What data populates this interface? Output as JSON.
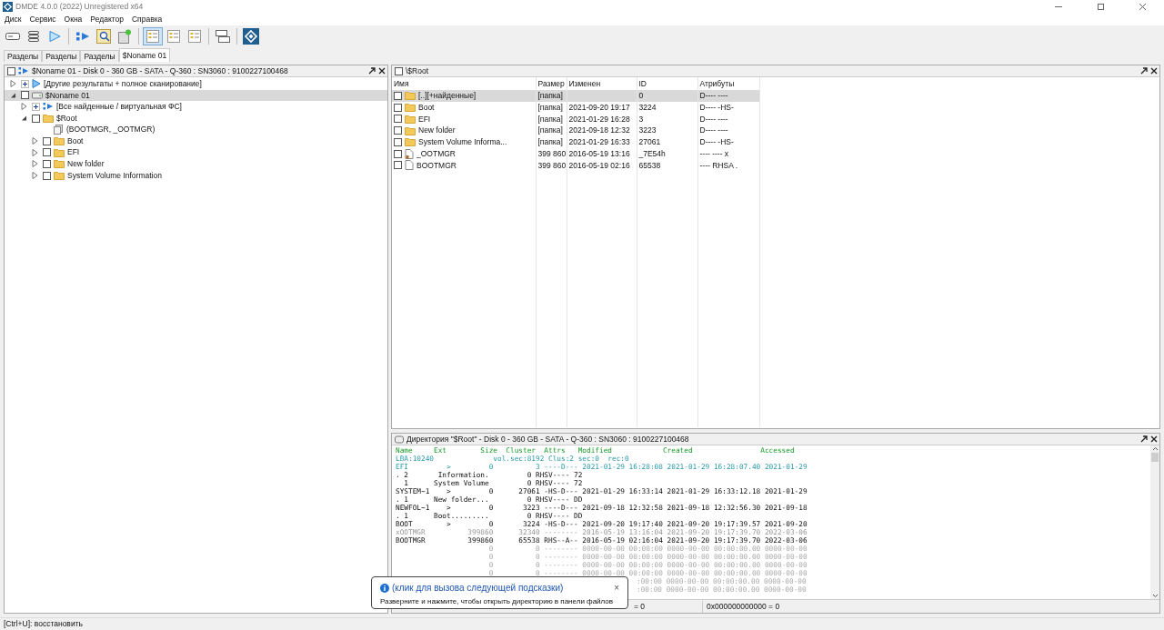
{
  "window": {
    "title": "DMDE 4.0.0 (2022) Unregistered x64"
  },
  "menu": [
    "Диск",
    "Сервис",
    "Окна",
    "Редактор",
    "Справка"
  ],
  "toolbar": [
    {
      "kind": "drive",
      "selected": false
    },
    {
      "kind": "list",
      "selected": false
    },
    {
      "kind": "play",
      "selected": false
    },
    {
      "kind": "sep"
    },
    {
      "kind": "scan",
      "selected": false
    },
    {
      "kind": "find",
      "selected": false
    },
    {
      "kind": "newfile",
      "selected": false
    },
    {
      "kind": "sep"
    },
    {
      "kind": "view",
      "selected": true
    },
    {
      "kind": "view",
      "selected": false
    },
    {
      "kind": "view",
      "selected": false
    },
    {
      "kind": "sep"
    },
    {
      "kind": "windows",
      "selected": false
    },
    {
      "kind": "sep"
    },
    {
      "kind": "logo",
      "selected": false
    }
  ],
  "tabs": [
    {
      "label": "Разделы",
      "selected": false
    },
    {
      "label": "Разделы",
      "selected": false
    },
    {
      "label": "Разделы",
      "selected": false
    },
    {
      "label": "$Noname 01",
      "selected": true
    }
  ],
  "tree_panel": {
    "title": "$Noname 01 - Disk 0 - 360 GB - SATA - Q-360 : SN3060 : 9100227100468",
    "checked": false,
    "items": [
      {
        "kind": "scan",
        "label": "[Другие результаты + полное сканирование]",
        "expanded": false,
        "selected": false
      },
      {
        "kind": "drive",
        "label": "$Noname 01",
        "expanded": true,
        "checked": false,
        "selected": true,
        "children": [
          {
            "kind": "virtual",
            "label": "[Все найденные / виртуальная ФС]",
            "expanded": false,
            "selected": false
          },
          {
            "kind": "folder",
            "label": "$Root",
            "expanded": true,
            "checked": false,
            "selected": false,
            "children": [
              {
                "kind": "files",
                "label": "(BOOTMGR, _OOTMGR)",
                "selected": false
              },
              {
                "kind": "folder",
                "label": "Boot",
                "expanded": false,
                "checked": false,
                "selected": false
              },
              {
                "kind": "folder",
                "label": "EFI",
                "expanded": false,
                "checked": false,
                "selected": false
              },
              {
                "kind": "folder",
                "label": "New folder",
                "expanded": false,
                "checked": false,
                "selected": false
              },
              {
                "kind": "folder",
                "label": "System Volume Information",
                "expanded": false,
                "checked": false,
                "selected": false
              }
            ]
          }
        ]
      }
    ]
  },
  "files_panel": {
    "title": "\\$Root",
    "checked": false,
    "columns": [
      "Имя",
      "Размер",
      "Изменен",
      "ID",
      "Атрибуты"
    ],
    "rows": [
      {
        "kind": "folder",
        "checked": false,
        "selected": true,
        "cells": [
          "[..][+найденные]",
          "[папка]",
          "",
          "0",
          "D---- ----"
        ]
      },
      {
        "kind": "folder",
        "checked": false,
        "selected": false,
        "cells": [
          "Boot",
          "[папка]",
          "2021-09-20 19:17",
          "3224",
          "D---- -HS-"
        ]
      },
      {
        "kind": "folder",
        "checked": false,
        "selected": false,
        "cells": [
          "EFI",
          "[папка]",
          "2021-01-29 16:28",
          "3",
          "D---- ----"
        ]
      },
      {
        "kind": "folder",
        "checked": false,
        "selected": false,
        "cells": [
          "New folder",
          "[папка]",
          "2021-09-18 12:32",
          "3223",
          "D---- ----"
        ]
      },
      {
        "kind": "folder",
        "checked": false,
        "selected": false,
        "cells": [
          "System Volume Informa...",
          "[папка]",
          "2021-01-29 16:33",
          "27061",
          "D---- -HS-"
        ]
      },
      {
        "kind": "deleted",
        "checked": false,
        "selected": false,
        "cells": [
          "_OOTMGR",
          "399 860",
          "2016-05-19 13:16",
          "_7E54h",
          "---- ---- x"
        ]
      },
      {
        "kind": "file",
        "checked": false,
        "selected": false,
        "cells": [
          "BOOTMGR",
          "399 860",
          "2016-05-19 02:16",
          "65538",
          "---- RHSA ."
        ]
      }
    ]
  },
  "dir_panel": {
    "title": "Директория \"$Root\" - Disk 0 - 360 GB - SATA - Q-360 : SN3060 : 9100227100468",
    "lines": [
      {
        "kind": "header",
        "text": "Name     Ext        Size  Cluster  Attrs   Modified            Created                Accessed"
      },
      {
        "kind": "info",
        "text": "LBA:10240              vol.sec:8192 Clus:2 sec:0  rec:0"
      },
      {
        "kind": "info",
        "text": "EFI         >         0          3 ----D--- 2021-01-29 16:28:08 2021-01-29 16:28:07.40 2021-01-29"
      },
      {
        "kind": "normal",
        "text": ". 2       Information.         0 RHSV---- 72"
      },
      {
        "kind": "normal",
        "text": "  1      System Volume         0 RHSV---- 72"
      },
      {
        "kind": "entry",
        "text": "SYSTEM~1    >         0      27061 -HS-D--- 2021-01-29 16:33:14 2021-01-29 16:33:12.18 2021-01-29"
      },
      {
        "kind": "normal",
        "text": ". 1      New folder...         0 RHSV---- DD"
      },
      {
        "kind": "entry",
        "text": "NEWFOL~1    >         0       3223 ----D--- 2021-09-18 12:32:58 2021-09-18 12:32:56.30 2021-09-18"
      },
      {
        "kind": "normal",
        "text": ". 1      Boot.........         0 RHSV---- DD"
      },
      {
        "kind": "entry",
        "text": "BOOT        >         0       3224 -HS-D--- 2021-09-20 19:17:40 2021-09-20 19:17:39.57 2021-09-20"
      },
      {
        "kind": "deleted",
        "text": "xOOTMGR          399860      32340 -------- 2016-05-19 13:16:04 2021-09-20 19:17:39.70 2022-03-06"
      },
      {
        "kind": "normal",
        "text": "BOOTMGR          399860      65538 RHS--A-- 2016-05-19 02:16:04 2021-09-20 19:17:39.70 2022-03-06"
      },
      {
        "kind": "empty",
        "text": "                      0          0 -------- 0000-00-00 00:00:00 0000-00-00 00:00:00.00 0000-00-00"
      },
      {
        "kind": "empty",
        "text": "                      0          0 -------- 0000-00-00 00:00:00 0000-00-00 00:00:00.00 0000-00-00"
      },
      {
        "kind": "empty",
        "text": "                      0          0 -------- 0000-00-00 00:00:00 0000-00-00 00:00:00.00 0000-00-00"
      },
      {
        "kind": "empty",
        "text": "                      0          0 -------- 0000-00-00 00:00:00 0000-00-00 00:00:00.00 0000-00-00"
      },
      {
        "kind": "tail",
        "text": ":00:00 0000-00-00 00:00:00.00 0000-00-00"
      },
      {
        "kind": "tail",
        "text": ":00:00 0000-00-00 00:00:00.00 0000-00-00"
      }
    ],
    "status": [
      "= 0",
      "0x000000000000 = 0"
    ]
  },
  "tooltip": {
    "title": "(клик для вызова следующей подсказки)",
    "close": "×",
    "text": "Разверните и нажмите, чтобы открыть директорию в панели файлов"
  },
  "status_bar": "[Ctrl+U]: восстановить"
}
